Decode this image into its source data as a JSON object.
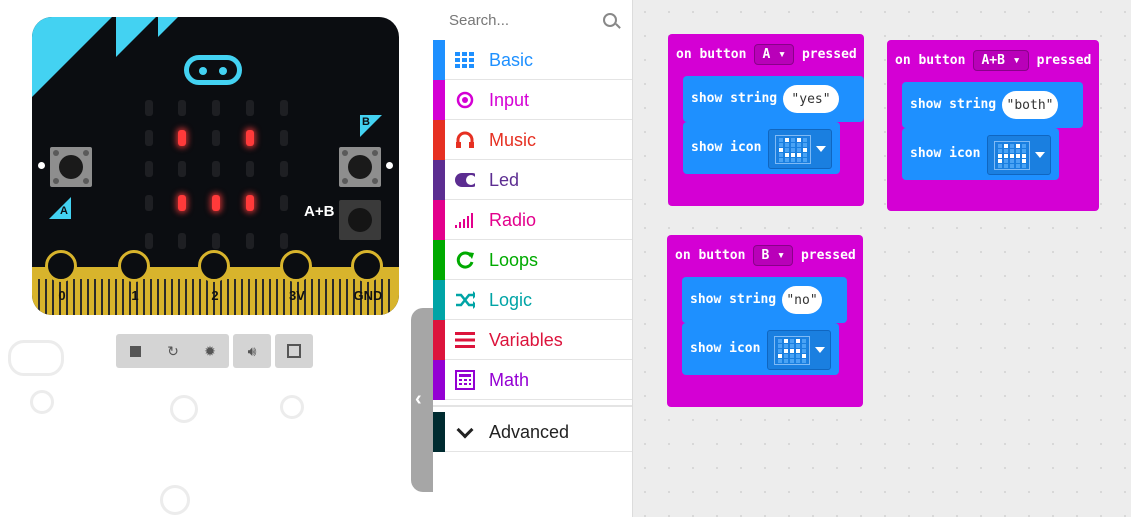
{
  "simulator": {
    "button_labels": {
      "a": "A",
      "b": "B",
      "ab": "A+B"
    },
    "pins": [
      "0",
      "1",
      "2",
      "3V",
      "GND"
    ],
    "led_matrix": [
      [
        0,
        0,
        0,
        0,
        0
      ],
      [
        0,
        1,
        0,
        1,
        0
      ],
      [
        0,
        0,
        0,
        0,
        0
      ],
      [
        0,
        1,
        1,
        1,
        0
      ],
      [
        0,
        0,
        0,
        0,
        0
      ]
    ],
    "controls": [
      "stop-icon",
      "restart-icon",
      "debug-icon",
      "sound-icon",
      "fullscreen-icon"
    ]
  },
  "toolbox": {
    "search_placeholder": "Search...",
    "categories": [
      {
        "label": "Basic",
        "color": "#1e90ff",
        "icon": "grid-icon"
      },
      {
        "label": "Input",
        "color": "#d400d4",
        "icon": "input-icon"
      },
      {
        "label": "Music",
        "color": "#e63022",
        "icon": "headphones-icon"
      },
      {
        "label": "Led",
        "color": "#5c2d91",
        "icon": "toggle-icon"
      },
      {
        "label": "Radio",
        "color": "#e3008c",
        "icon": "signal-icon"
      },
      {
        "label": "Loops",
        "color": "#00aa00",
        "icon": "refresh-icon"
      },
      {
        "label": "Logic",
        "color": "#00a4a6",
        "icon": "shuffle-icon"
      },
      {
        "label": "Variables",
        "color": "#dc143c",
        "icon": "lines-icon"
      },
      {
        "label": "Math",
        "color": "#9400d3",
        "icon": "calculator-icon"
      }
    ],
    "advanced": {
      "label": "Advanced",
      "color": "#002b30",
      "icon": "chevron-down-icon"
    }
  },
  "workspace": {
    "blocks": [
      {
        "event_prefix": "on button",
        "button": "A",
        "event_suffix": "pressed",
        "show_string_label": "show string",
        "string_value": "\"yes\"",
        "show_icon_label": "show icon"
      },
      {
        "event_prefix": "on button",
        "button": "A+B",
        "event_suffix": "pressed",
        "show_string_label": "show string",
        "string_value": "\"both\"",
        "show_icon_label": "show icon"
      },
      {
        "event_prefix": "on button",
        "button": "B",
        "event_suffix": "pressed",
        "show_string_label": "show string",
        "string_value": "\"no\"",
        "show_icon_label": "show icon"
      }
    ]
  }
}
